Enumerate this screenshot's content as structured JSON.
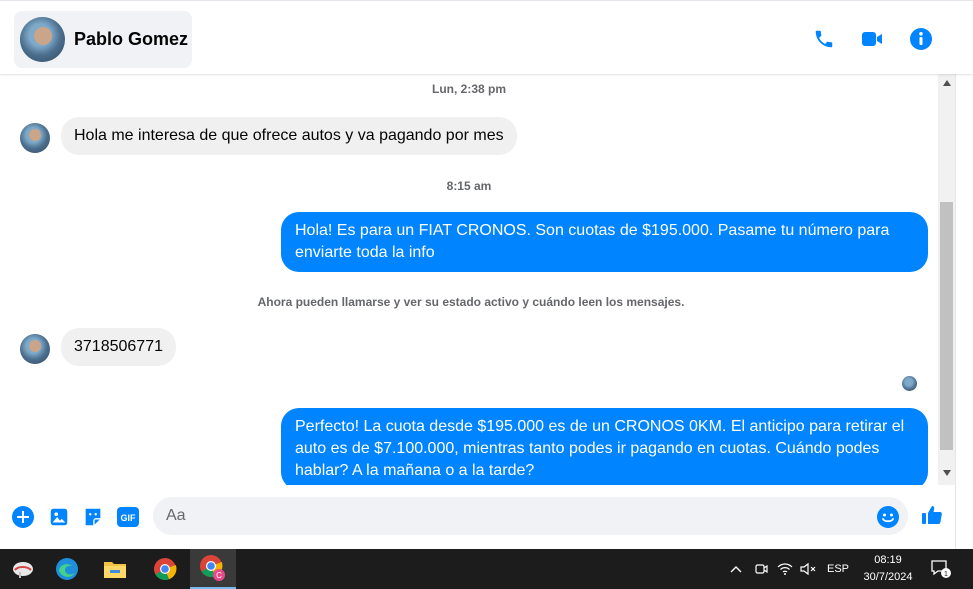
{
  "header": {
    "contact_name": "Pablo Gomez",
    "icons": [
      "phone-icon",
      "video-camera-icon",
      "info-icon"
    ]
  },
  "chat": {
    "timestamp1": "Lun, 2:38 pm",
    "msg1": "Hola me interesa de que ofrece autos y va pagando por mes",
    "timestamp2": "8:15 am",
    "msg2": "Hola! Es para un FIAT CRONOS. Son cuotas de $195.000. Pasame tu número para enviarte toda la info",
    "notice": "Ahora pueden llamarse y ver su estado activo y cuándo leen los mensajes.",
    "msg3": "3718506771",
    "msg4": "Perfecto! La cuota desde $195.000 es de un CRONOS 0KM. El anticipo para retirar el auto es de $7.100.000, mientras tanto podes ir pagando en cuotas. Cuándo podes hablar? A la mañana o a la tarde?"
  },
  "composer": {
    "placeholder": "Aa",
    "icons": [
      "plus-icon",
      "image-icon",
      "sticker-icon",
      "gif-icon",
      "emoji-icon",
      "thumbs-up-icon"
    ],
    "gif_label": "GIF"
  },
  "taskbar": {
    "language": "ESP",
    "time": "08:19",
    "date": "30/7/2024",
    "notification_count": "1",
    "chrome_badge": "C"
  },
  "colors": {
    "accent": "#0084ff",
    "incoming_bubble": "#f0f0f0",
    "taskbar": "#1c1c1c"
  }
}
